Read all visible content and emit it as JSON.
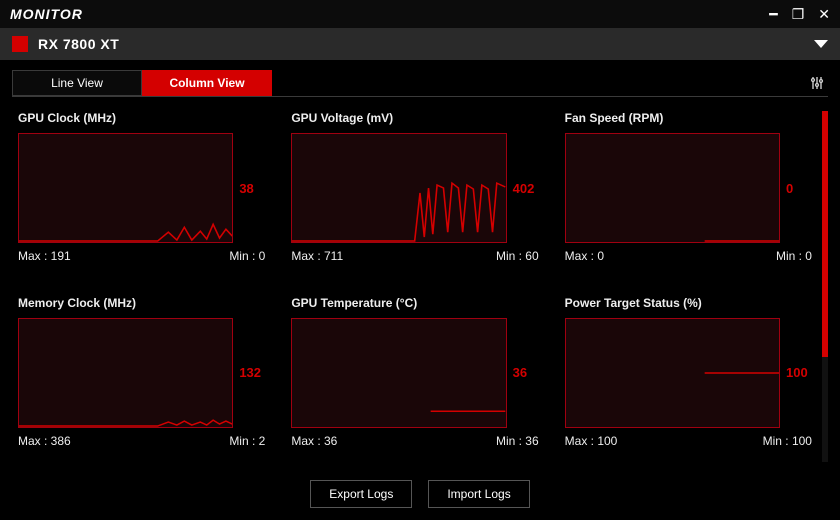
{
  "app": {
    "title": "MONITOR"
  },
  "device": {
    "name": "RX 7800 XT",
    "color": "#d40000"
  },
  "tabs": {
    "line": "Line View",
    "column": "Column View"
  },
  "cards": {
    "gpu_clock": {
      "title": "GPU Clock (MHz)",
      "current": "38",
      "max": "Max : 191",
      "min": "Min : 0"
    },
    "gpu_volt": {
      "title": "GPU Voltage (mV)",
      "current": "402",
      "max": "Max : 711",
      "min": "Min : 60"
    },
    "fan": {
      "title": "Fan Speed (RPM)",
      "current": "0",
      "max": "Max : 0",
      "min": "Min : 0"
    },
    "mem_clock": {
      "title": "Memory Clock (MHz)",
      "current": "132",
      "max": "Max : 386",
      "min": "Min : 2"
    },
    "gpu_temp": {
      "title": "GPU Temperature (°C)",
      "current": "36",
      "max": "Max : 36",
      "min": "Min : 36"
    },
    "power": {
      "title": "Power Target Status (%)",
      "current": "100",
      "max": "Max : 100",
      "min": "Min : 100"
    }
  },
  "buttons": {
    "export": "Export Logs",
    "import": "Import Logs"
  }
}
